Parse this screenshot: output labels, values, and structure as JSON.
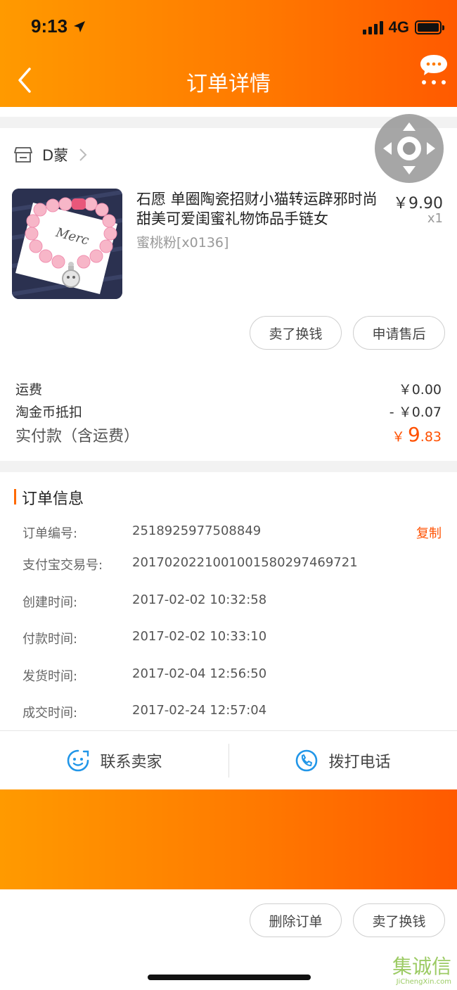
{
  "status_bar": {
    "time": "9:13",
    "network": "4G"
  },
  "nav": {
    "title": "订单详情"
  },
  "shop": {
    "name": "D蒙"
  },
  "product": {
    "title": "石愿 单圈陶瓷招财小猫转运辟邪时尚甜美可爱闺蜜礼物饰品手链女",
    "sku": "蜜桃粉[x0136]",
    "price": "￥9.90",
    "qty": "x1",
    "image_text": "Merc"
  },
  "item_actions": {
    "sell_label": "卖了换钱",
    "aftersale_label": "申请售后"
  },
  "fees": {
    "shipping_label": "运费",
    "shipping_value": "￥0.00",
    "coin_label": "淘金币抵扣",
    "coin_value": "- ￥0.07",
    "total_label": "实付款（含运费）",
    "total_currency": "￥",
    "total_int": "9",
    "total_dec": ".83"
  },
  "order_info": {
    "title": "订单信息",
    "copy_label": "复制",
    "rows": [
      {
        "label": "订单编号:",
        "value": "2518925977508849"
      },
      {
        "label": "支付宝交易号:",
        "value": "2017020221001001580297469721"
      },
      {
        "label": "创建时间:",
        "value": "2017-02-02 10:32:58"
      },
      {
        "label": "付款时间:",
        "value": "2017-02-02 10:33:10"
      },
      {
        "label": "发货时间:",
        "value": "2017-02-04 12:56:50"
      },
      {
        "label": "成交时间:",
        "value": "2017-02-24 12:57:04"
      }
    ]
  },
  "contact": {
    "seller_label": "联系卖家",
    "call_label": "拨打电话"
  },
  "bottom_actions": {
    "delete_label": "删除订单",
    "sell_label": "卖了换钱"
  },
  "watermark": {
    "cn": "集诚信",
    "en": "JiChengXin.com"
  },
  "colors": {
    "brand_orange": "#ff7a00",
    "price_red": "#ff5000",
    "contact_blue": "#2196e8"
  },
  "icons": [
    "location-arrow-icon",
    "signal-icon",
    "battery-icon",
    "back-icon",
    "chat-bubble-icon",
    "store-icon",
    "chevron-right-icon",
    "seller-face-icon",
    "phone-icon"
  ]
}
